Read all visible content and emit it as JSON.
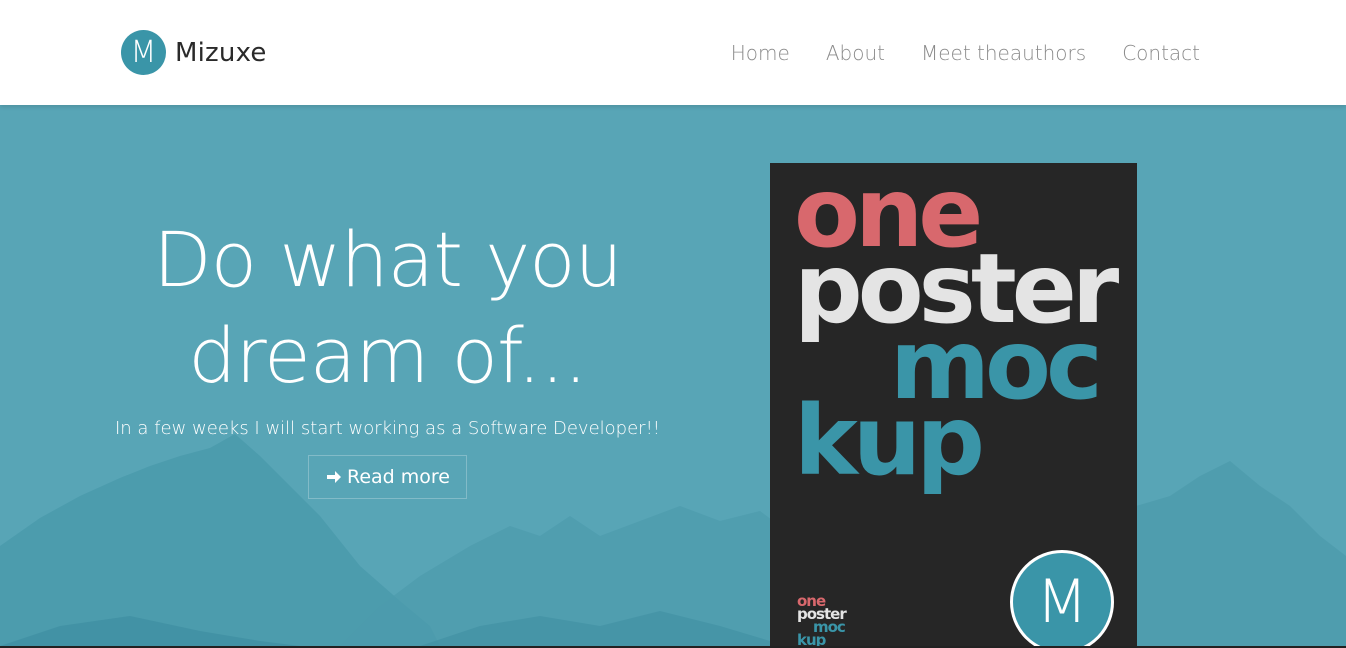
{
  "header": {
    "logo_letter": "M",
    "brand_name": "Mizuxe",
    "nav": [
      {
        "label": "Home"
      },
      {
        "label": "About"
      },
      {
        "label": "Meet theauthors"
      },
      {
        "label": "Contact"
      }
    ]
  },
  "hero": {
    "title_line1": "Do what you",
    "title_line2": "dream of...",
    "subtitle": "In a few weeks I will start working as a Software Developer!!",
    "button_label": "Read more",
    "button_icon": "arrow-right-icon",
    "background_color": "#58a5b6"
  },
  "poster": {
    "word1": "one",
    "word2": "poster",
    "word3": "moc",
    "word4": "kup",
    "badge_letter": "M",
    "small_word1": "one",
    "small_word2": "poster",
    "small_word3": "moc",
    "small_word4": "kup",
    "colors": {
      "red": "#d8686d",
      "white": "#e4e4e4",
      "teal": "#3a95a8",
      "background": "#262626"
    }
  }
}
